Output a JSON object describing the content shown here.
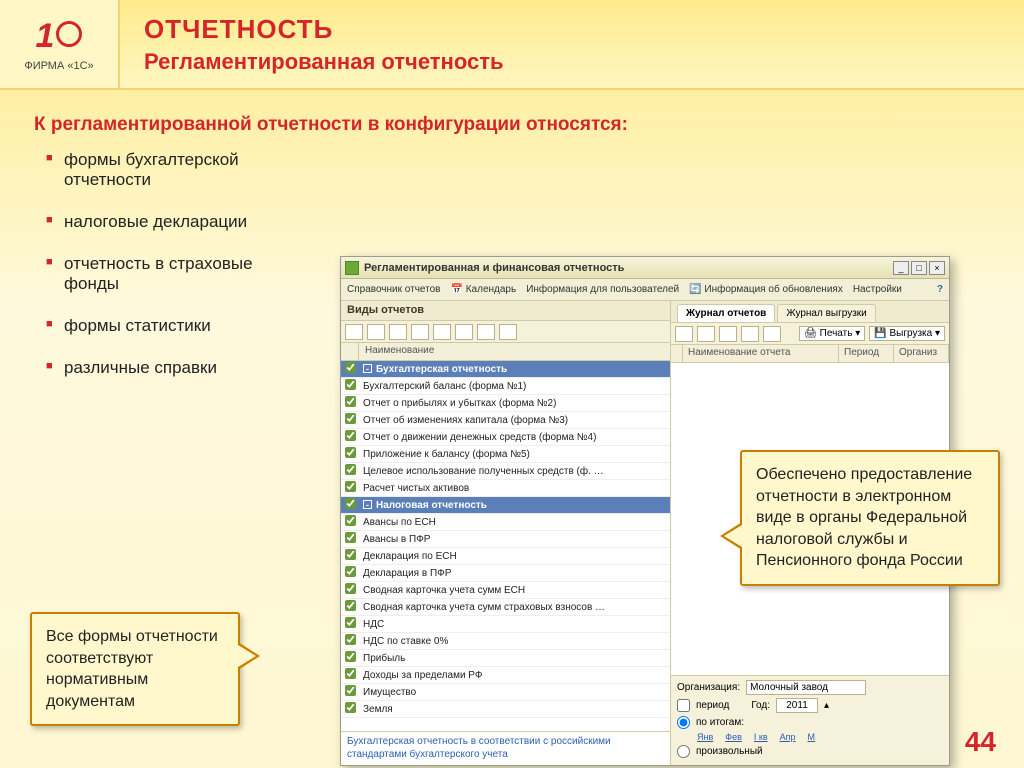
{
  "header": {
    "title": "ОТЧЕТНОСТЬ",
    "subtitle": "Регламентированная отчетность",
    "logo_caption": "ФИРМА «1С»"
  },
  "lead": "К регламентированной отчетности в конфигурации относятся:",
  "bullets": [
    "формы бухгалтерской отчетности",
    "налоговые декларации",
    "отчетность в страховые фонды",
    "формы статистики",
    "различные справки"
  ],
  "callout_left": "Все формы отчетности соответствуют нормативным документам",
  "callout_right": "Обеспечено предоставление отчетности в электронном виде в органы Федеральной налоговой службы и Пенсионного фонда России",
  "page_number": "44",
  "window": {
    "title": "Регламентированная и финансовая отчетность",
    "menu": [
      "Справочник отчетов",
      "Календарь",
      "Информация для пользователей",
      "Информация об обновлениях",
      "Настройки"
    ],
    "left": {
      "pane_title": "Виды отчетов",
      "column": "Наименование",
      "sections": [
        {
          "title": "Бухгалтерская отчетность",
          "items": [
            "Бухгалтерский баланс (форма №1)",
            "Отчет о прибылях и убытках (форма №2)",
            "Отчет об изменениях капитала (форма №3)",
            "Отчет о движении денежных средств (форма №4)",
            "Приложение к балансу (форма №5)",
            "Целевое использование полученных средств (ф. …",
            "Расчет чистых активов"
          ]
        },
        {
          "title": "Налоговая отчетность",
          "items": [
            "Авансы по ЕСН",
            "Авансы в ПФР",
            "Декларация по ЕСН",
            "Декларация в ПФР",
            "Сводная карточка учета сумм ЕСН",
            "Сводная карточка учета сумм страховых взносов …",
            "НДС",
            "НДС по ставке 0%",
            "Прибыль",
            "Доходы за пределами РФ",
            "Имущество",
            "Земля"
          ]
        }
      ],
      "footnote": "Бухгалтерская отчетность в соответствии с российскими стандартами бухгалтерского учета"
    },
    "right": {
      "tabs": [
        "Журнал отчетов",
        "Журнал выгрузки"
      ],
      "toolbar": {
        "print": "Печать",
        "export": "Выгрузка"
      },
      "columns": [
        "Наименование отчета",
        "Период",
        "Организ"
      ],
      "org_label": "Организация:",
      "org_value": "Молочный завод",
      "period_label": "период",
      "year_label": "Год:",
      "year_value": "2011",
      "mode_results": "по итогам:",
      "mode_custom": "произвольный",
      "months": [
        "Янв",
        "Фев",
        "I кв",
        "Апр",
        "М"
      ]
    }
  }
}
